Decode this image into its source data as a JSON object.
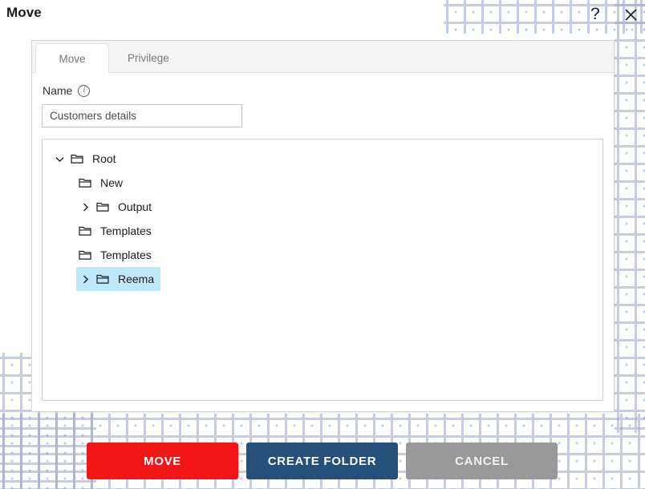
{
  "header": {
    "title": "Move",
    "help_icon": "question-mark-icon",
    "help_label": "?",
    "close_icon": "close-icon",
    "close_label": "✕"
  },
  "dialog": {
    "tabs": [
      {
        "label": "Move",
        "active": true
      },
      {
        "label": "Privilege",
        "active": false
      }
    ],
    "name_field": {
      "label": "Name",
      "info_icon": "info-icon",
      "info_glyph": "i",
      "value": "Customers details",
      "placeholder": "Name"
    },
    "tree": {
      "nodes": [
        {
          "label": "Root",
          "depth": 0,
          "chevron": "down",
          "selected": false
        },
        {
          "label": "New",
          "depth": 1,
          "chevron": "none",
          "selected": false
        },
        {
          "label": "Output",
          "depth": 1,
          "chevron": "right",
          "selected": false
        },
        {
          "label": "Templates",
          "depth": 1,
          "chevron": "none",
          "selected": false
        },
        {
          "label": "Templates",
          "depth": 1,
          "chevron": "none",
          "selected": false
        },
        {
          "label": "Reema",
          "depth": 1,
          "chevron": "right",
          "selected": true
        }
      ]
    }
  },
  "footer": {
    "move_label": "MOVE",
    "create_folder_label": "CREATE FOLDER",
    "cancel_label": "CANCEL"
  },
  "colors": {
    "move_red": "#f41616",
    "create_navy": "#255079",
    "cancel_gray": "#999999",
    "selection_blue": "#bde8f9",
    "pattern_blue": "#97a3d6"
  }
}
